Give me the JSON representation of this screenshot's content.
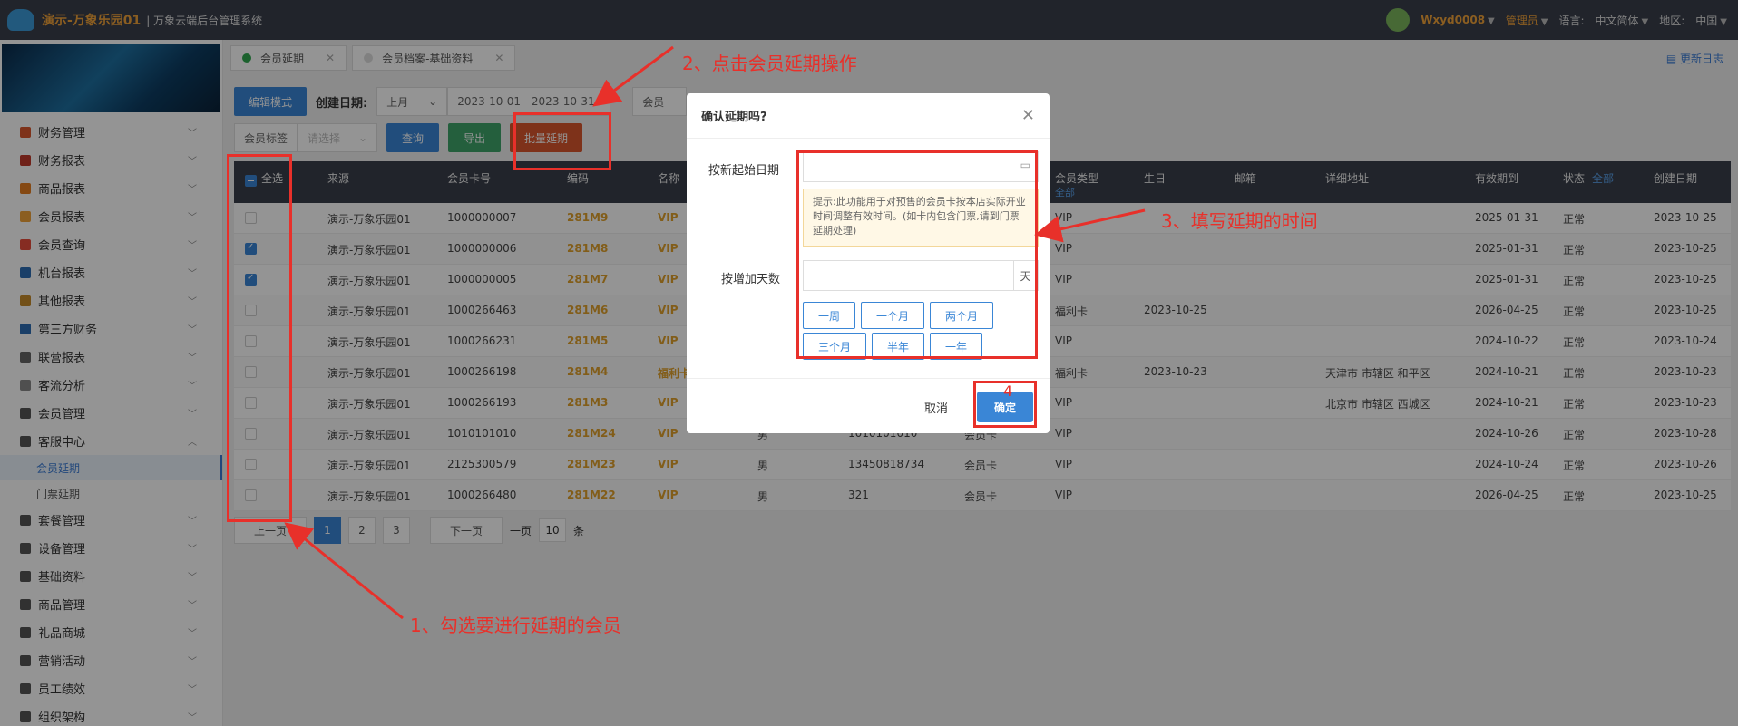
{
  "header": {
    "app_title": "演示-万象乐园01",
    "app_sub": "| 万象云端后台管理系统",
    "user": "Wxyd0008",
    "role": "管理员",
    "language_label": "语言:",
    "language": "中文简体",
    "region_label": "地区:",
    "region": "中国"
  },
  "sidebar": {
    "items": [
      {
        "label": "财务管理",
        "color": "#d9562d"
      },
      {
        "label": "财务报表",
        "color": "#c0392b"
      },
      {
        "label": "商品报表",
        "color": "#e67e22"
      },
      {
        "label": "会员报表",
        "color": "#f0a23a"
      },
      {
        "label": "会员查询",
        "color": "#e74c3c"
      },
      {
        "label": "机台报表",
        "color": "#2e6db4"
      },
      {
        "label": "其他报表",
        "color": "#c58a2a"
      },
      {
        "label": "第三方财务",
        "color": "#2e6db4"
      },
      {
        "label": "联营报表",
        "color": "#666666"
      },
      {
        "label": "客流分析",
        "color": "#888888"
      },
      {
        "label": "会员管理",
        "color": "#555555"
      },
      {
        "label": "客服中心",
        "color": "#555555"
      }
    ],
    "subitems": [
      "会员延期",
      "门票延期"
    ],
    "items_after": [
      {
        "label": "套餐管理",
        "color": "#555555"
      },
      {
        "label": "设备管理",
        "color": "#555555"
      },
      {
        "label": "基础资料",
        "color": "#555555"
      },
      {
        "label": "商品管理",
        "color": "#555555"
      },
      {
        "label": "礼品商城",
        "color": "#555555"
      },
      {
        "label": "营销活动",
        "color": "#555555"
      },
      {
        "label": "员工绩效",
        "color": "#555555"
      },
      {
        "label": "组织架构",
        "color": "#555555"
      }
    ]
  },
  "tabs": [
    {
      "label": "会员延期",
      "dot": "#2fa84f"
    },
    {
      "label": "会员档案-基础资料",
      "dot": "#dddddd"
    }
  ],
  "update_log": "更新日志",
  "toolbar": {
    "edit_mode": "编辑模式",
    "create_date_label": "创建日期:",
    "period": "上月",
    "date_range": "2023-10-01 - 2023-10-31",
    "member_label": "会员",
    "member_tag_label": "会员标签",
    "placeholder_select": "请选择",
    "query": "查询",
    "export": "导出",
    "batch_extend": "批量延期"
  },
  "table": {
    "headers": {
      "select_all": "全选",
      "source": "来源",
      "card_no": "会员卡号",
      "code": "编码",
      "name": "名称",
      "member_type": "会员类型",
      "member_type_sub": "全部",
      "birthday": "生日",
      "email": "邮箱",
      "address": "详细地址",
      "valid_until": "有效期到",
      "status": "状态",
      "status_filter": "全部",
      "created": "创建日期"
    },
    "rows": [
      {
        "checked": false,
        "source": "演示-万象乐园01",
        "card": "1000000007",
        "code": "281M9",
        "name": "VIP",
        "gender": "",
        "phone": "",
        "card_type": "",
        "type": "VIP",
        "birthday": "",
        "address": "",
        "valid": "2025-01-31",
        "status": "正常",
        "created": "2023-10-25"
      },
      {
        "checked": true,
        "source": "演示-万象乐园01",
        "card": "1000000006",
        "code": "281M8",
        "name": "VIP",
        "gender": "",
        "phone": "",
        "card_type": "",
        "type": "VIP",
        "birthday": "",
        "address": "",
        "valid": "2025-01-31",
        "status": "正常",
        "created": "2023-10-25"
      },
      {
        "checked": true,
        "source": "演示-万象乐园01",
        "card": "1000000005",
        "code": "281M7",
        "name": "VIP",
        "gender": "",
        "phone": "",
        "card_type": "",
        "type": "VIP",
        "birthday": "",
        "address": "",
        "valid": "2025-01-31",
        "status": "正常",
        "created": "2023-10-25"
      },
      {
        "checked": false,
        "source": "演示-万象乐园01",
        "card": "1000266463",
        "code": "281M6",
        "name": "VIP",
        "gender": "",
        "phone": "",
        "card_type": "",
        "type": "福利卡",
        "birthday": "2023-10-25",
        "address": "",
        "valid": "2026-04-25",
        "status": "正常",
        "created": "2023-10-25"
      },
      {
        "checked": false,
        "source": "演示-万象乐园01",
        "card": "1000266231",
        "code": "281M5",
        "name": "VIP",
        "gender": "",
        "phone": "",
        "card_type": "",
        "type": "VIP",
        "birthday": "",
        "address": "",
        "valid": "2024-10-22",
        "status": "正常",
        "created": "2023-10-24"
      },
      {
        "checked": false,
        "source": "演示-万象乐园01",
        "card": "1000266198",
        "code": "281M4",
        "name": "福利卡",
        "gender": "",
        "phone": "",
        "card_type": "",
        "type": "福利卡",
        "birthday": "2023-10-23",
        "address": "天津市 市辖区 和平区",
        "valid": "2024-10-21",
        "status": "正常",
        "created": "2023-10-23"
      },
      {
        "checked": false,
        "source": "演示-万象乐园01",
        "card": "1000266193",
        "code": "281M3",
        "name": "VIP",
        "gender": "",
        "phone": "",
        "card_type": "",
        "type": "VIP",
        "birthday": "",
        "address": "北京市 市辖区 西城区",
        "valid": "2024-10-21",
        "status": "正常",
        "created": "2023-10-23"
      },
      {
        "checked": false,
        "source": "演示-万象乐园01",
        "card": "1010101010",
        "code": "281M24",
        "name": "VIP",
        "gender": "男",
        "phone": "1010101010",
        "card_type": "会员卡",
        "type": "VIP",
        "birthday": "",
        "address": "",
        "valid": "2024-10-26",
        "status": "正常",
        "created": "2023-10-28"
      },
      {
        "checked": false,
        "source": "演示-万象乐园01",
        "card": "2125300579",
        "code": "281M23",
        "name": "VIP",
        "gender": "男",
        "phone": "13450818734",
        "card_type": "会员卡",
        "type": "VIP",
        "birthday": "",
        "address": "",
        "valid": "2024-10-24",
        "status": "正常",
        "created": "2023-10-26"
      },
      {
        "checked": false,
        "source": "演示-万象乐园01",
        "card": "1000266480",
        "code": "281M22",
        "name": "VIP",
        "gender": "男",
        "phone": "321",
        "card_type": "会员卡",
        "type": "VIP",
        "birthday": "",
        "address": "",
        "valid": "2026-04-25",
        "status": "正常",
        "created": "2023-10-25"
      }
    ]
  },
  "pager": {
    "prev": "上一页",
    "pages": [
      "1",
      "2",
      "3"
    ],
    "next": "下一页",
    "per_page_label": "一页",
    "per_page": "10",
    "unit": "条"
  },
  "modal": {
    "title": "确认延期吗?",
    "new_start_label": "按新起始日期",
    "tip": "提示:此功能用于对预售的会员卡按本店实际开业时间调整有效时间。(如卡内包含门票,请到门票延期处理)",
    "add_days_label": "按增加天数",
    "day_unit": "天",
    "quick": [
      "一周",
      "一个月",
      "两个月",
      "三个月",
      "半年",
      "一年"
    ],
    "cancel": "取消",
    "confirm": "确定"
  },
  "annotations": {
    "step1": "1、勾选要进行延期的会员",
    "step2": "2、点击会员延期操作",
    "step3": "3、填写延期的时间",
    "step4": "4"
  }
}
